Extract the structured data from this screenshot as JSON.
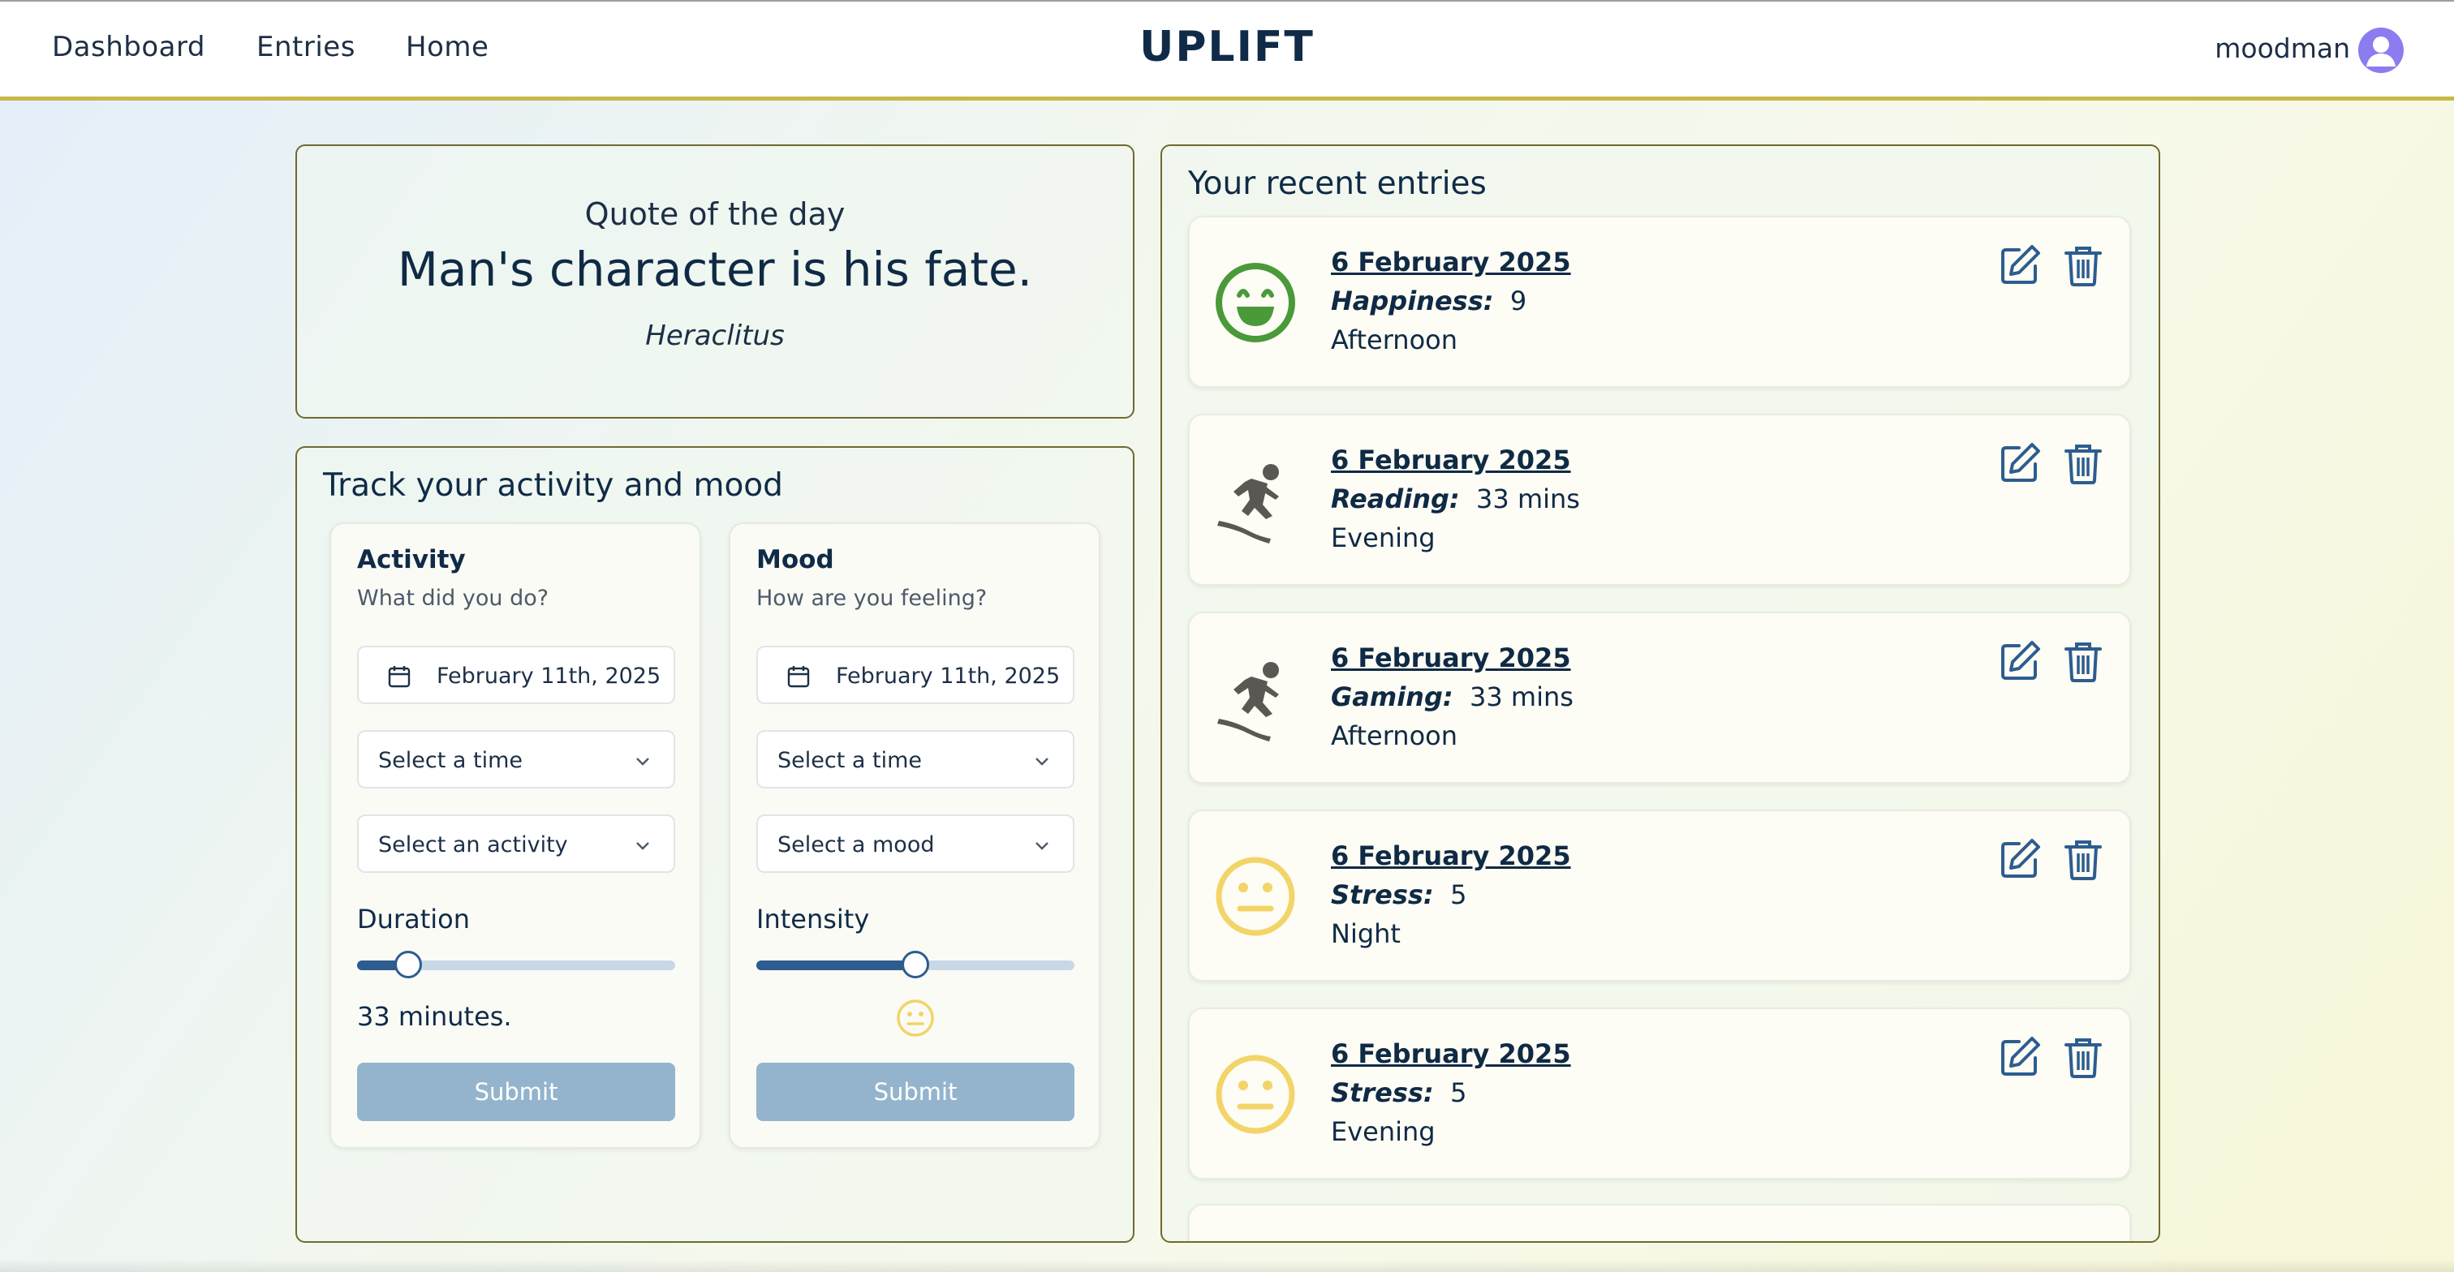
{
  "nav": {
    "links": [
      "Dashboard",
      "Entries",
      "Home"
    ],
    "brand": "UPLIFT",
    "username": "moodman",
    "avatar_icon": "user-avatar-icon"
  },
  "quote": {
    "label": "Quote of the day",
    "text": "Man's character is his fate.",
    "author": "Heraclitus"
  },
  "tracker": {
    "title": "Track your activity and mood",
    "activity": {
      "title": "Activity",
      "subtitle": "What did you do?",
      "date": "February 11th, 2025",
      "time_placeholder": "Select a time",
      "select_placeholder": "Select an activity",
      "slider_label": "Duration",
      "slider_value": 0.16,
      "value_text": "33 minutes.",
      "submit": "Submit"
    },
    "mood": {
      "title": "Mood",
      "subtitle": "How are you feeling?",
      "date": "February 11th, 2025",
      "time_placeholder": "Select a time",
      "select_placeholder": "Select a mood",
      "slider_label": "Intensity",
      "slider_value": 0.5,
      "face_icon": "neutral-face-icon",
      "submit": "Submit"
    }
  },
  "entries": {
    "title": "Your recent entries",
    "items": [
      {
        "date": "6 February 2025",
        "label": "Happiness:",
        "value": "9",
        "time": "Afternoon",
        "icon": "grinning-face-icon"
      },
      {
        "date": "6 February 2025",
        "label": "Reading:",
        "value": "33 mins",
        "time": "Evening",
        "icon": "snowboarder-icon"
      },
      {
        "date": "6 February 2025",
        "label": "Gaming:",
        "value": "33 mins",
        "time": "Afternoon",
        "icon": "snowboarder-icon"
      },
      {
        "date": "6 February 2025",
        "label": "Stress:",
        "value": "5",
        "time": "Night",
        "icon": "neutral-face-icon"
      },
      {
        "date": "6 February 2025",
        "label": "Stress:",
        "value": "5",
        "time": "Evening",
        "icon": "neutral-face-icon"
      }
    ]
  },
  "colors": {
    "navbar_border": "#c8b94a",
    "card_border": "#6f6a2e",
    "slider_fill": "#2d5d8f",
    "submit_bg": "#93b4cc",
    "happy_green": "#4a9a3a",
    "neutral_yellow": "#f2d468",
    "icon_blue": "#2d5d8f",
    "activity_gray": "#5b5753"
  }
}
